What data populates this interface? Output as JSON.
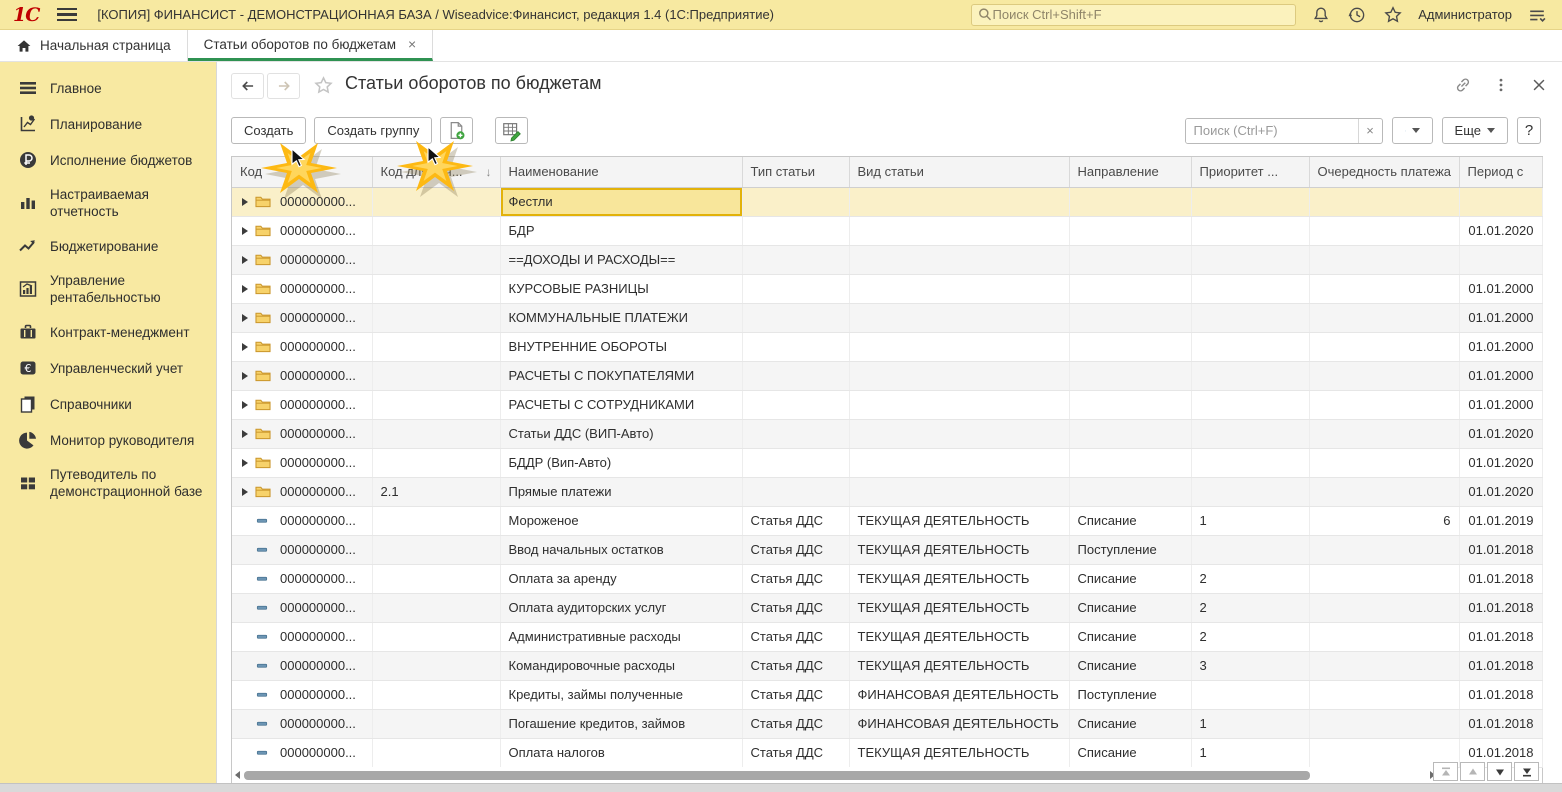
{
  "titlebar": {
    "logo": "1С",
    "title": "[КОПИЯ] ФИНАНСИСТ - ДЕМОНСТРАЦИОННАЯ БАЗА / Wiseadvice:Финансист, редакция 1.4  (1С:Предприятие)",
    "search_placeholder": "Поиск Ctrl+Shift+F",
    "user": "Администратор"
  },
  "tabs": [
    {
      "label": "Начальная страница",
      "icon": "home-icon",
      "active": false
    },
    {
      "label": "Статьи оборотов по бюджетам",
      "close": "×",
      "active": true
    }
  ],
  "sidebar": [
    {
      "label": "Главное",
      "icon": "menu"
    },
    {
      "label": "Планирование",
      "icon": "planning"
    },
    {
      "label": "Исполнение бюджетов",
      "icon": "ruble"
    },
    {
      "label": "Настраиваемая отчетность",
      "icon": "bars"
    },
    {
      "label": "Бюджетирование",
      "icon": "trend"
    },
    {
      "label": "Управление рентабельностью",
      "icon": "chartframe"
    },
    {
      "label": "Контракт-менеджмент",
      "icon": "briefcase"
    },
    {
      "label": "Управленческий учет",
      "icon": "euro"
    },
    {
      "label": "Справочники",
      "icon": "pages"
    },
    {
      "label": "Монитор руководителя",
      "icon": "pie"
    },
    {
      "label": "Путеводитель по демонстрационной базе",
      "icon": "grid"
    }
  ],
  "page": {
    "title": "Статьи оборотов по бюджетам",
    "toolbar": {
      "create": "Создать",
      "create_group": "Создать группу",
      "search_placeholder": "Поиск (Ctrl+F)",
      "clear": "×",
      "more": "Еще",
      "help": "?"
    }
  },
  "table": {
    "columns": [
      "Код",
      "Код для отч...",
      "Наименование",
      "Тип статьи",
      "Вид статьи",
      "Направление",
      "Приоритет ...",
      "Очередность платежа",
      "Период с"
    ],
    "sort_arrow": "↓",
    "rows": [
      {
        "kind": "group",
        "code": "000000000...",
        "code2": "",
        "name": "Фестли",
        "type": "",
        "view": "",
        "direction": "",
        "priority": "",
        "order": "",
        "period": "",
        "selected": true
      },
      {
        "kind": "group",
        "code": "000000000...",
        "code2": "",
        "name": "БДР",
        "type": "",
        "view": "",
        "direction": "",
        "priority": "",
        "order": "",
        "period": "01.01.2020",
        "selected": false
      },
      {
        "kind": "group",
        "code": "000000000...",
        "code2": "",
        "name": "==ДОХОДЫ И РАСХОДЫ==",
        "type": "",
        "view": "",
        "direction": "",
        "priority": "",
        "order": "",
        "period": "",
        "selected": false
      },
      {
        "kind": "group",
        "code": "000000000...",
        "code2": "",
        "name": "КУРСОВЫЕ РАЗНИЦЫ",
        "type": "",
        "view": "",
        "direction": "",
        "priority": "",
        "order": "",
        "period": "01.01.2000",
        "selected": false
      },
      {
        "kind": "group",
        "code": "000000000...",
        "code2": "",
        "name": "КОММУНАЛЬНЫЕ ПЛАТЕЖИ",
        "type": "",
        "view": "",
        "direction": "",
        "priority": "",
        "order": "",
        "period": "01.01.2000",
        "selected": false
      },
      {
        "kind": "group",
        "code": "000000000...",
        "code2": "",
        "name": "ВНУТРЕННИЕ ОБОРОТЫ",
        "type": "",
        "view": "",
        "direction": "",
        "priority": "",
        "order": "",
        "period": "01.01.2000",
        "selected": false
      },
      {
        "kind": "group",
        "code": "000000000...",
        "code2": "",
        "name": "РАСЧЕТЫ С ПОКУПАТЕЛЯМИ",
        "type": "",
        "view": "",
        "direction": "",
        "priority": "",
        "order": "",
        "period": "01.01.2000",
        "selected": false
      },
      {
        "kind": "group",
        "code": "000000000...",
        "code2": "",
        "name": "РАСЧЕТЫ С СОТРУДНИКАМИ",
        "type": "",
        "view": "",
        "direction": "",
        "priority": "",
        "order": "",
        "period": "01.01.2000",
        "selected": false
      },
      {
        "kind": "group",
        "code": "000000000...",
        "code2": "",
        "name": "Статьи ДДС (ВИП-Авто)",
        "type": "",
        "view": "",
        "direction": "",
        "priority": "",
        "order": "",
        "period": "01.01.2020",
        "selected": false
      },
      {
        "kind": "group",
        "code": "000000000...",
        "code2": "",
        "name": "БДДР (Вип-Авто)",
        "type": "",
        "view": "",
        "direction": "",
        "priority": "",
        "order": "",
        "period": "01.01.2020",
        "selected": false
      },
      {
        "kind": "group",
        "code": "000000000...",
        "code2": "2.1",
        "name": "Прямые платежи",
        "type": "",
        "view": "",
        "direction": "",
        "priority": "",
        "order": "",
        "period": "01.01.2020",
        "selected": false
      },
      {
        "kind": "item",
        "code": "000000000...",
        "code2": "",
        "name": "Мороженое",
        "type": "Статья ДДС",
        "view": "ТЕКУЩАЯ ДЕЯТЕЛЬНОСТЬ",
        "direction": "Списание",
        "priority": "1",
        "order": "6",
        "period": "01.01.2019",
        "selected": false
      },
      {
        "kind": "item",
        "code": "000000000...",
        "code2": "",
        "name": "Ввод начальных остатков",
        "type": "Статья ДДС",
        "view": "ТЕКУЩАЯ ДЕЯТЕЛЬНОСТЬ",
        "direction": "Поступление",
        "priority": "",
        "order": "",
        "period": "01.01.2018",
        "selected": false
      },
      {
        "kind": "item",
        "code": "000000000...",
        "code2": "",
        "name": "Оплата за аренду",
        "type": "Статья ДДС",
        "view": "ТЕКУЩАЯ ДЕЯТЕЛЬНОСТЬ",
        "direction": "Списание",
        "priority": "2",
        "order": "",
        "period": "01.01.2018",
        "selected": false
      },
      {
        "kind": "item",
        "code": "000000000...",
        "code2": "",
        "name": "Оплата аудиторских услуг",
        "type": "Статья ДДС",
        "view": "ТЕКУЩАЯ ДЕЯТЕЛЬНОСТЬ",
        "direction": "Списание",
        "priority": "2",
        "order": "",
        "period": "01.01.2018",
        "selected": false
      },
      {
        "kind": "item",
        "code": "000000000...",
        "code2": "",
        "name": "Административные расходы",
        "type": "Статья ДДС",
        "view": "ТЕКУЩАЯ ДЕЯТЕЛЬНОСТЬ",
        "direction": "Списание",
        "priority": "2",
        "order": "",
        "period": "01.01.2018",
        "selected": false
      },
      {
        "kind": "item",
        "code": "000000000...",
        "code2": "",
        "name": "Командировочные расходы",
        "type": "Статья ДДС",
        "view": "ТЕКУЩАЯ ДЕЯТЕЛЬНОСТЬ",
        "direction": "Списание",
        "priority": "3",
        "order": "",
        "period": "01.01.2018",
        "selected": false
      },
      {
        "kind": "item",
        "code": "000000000...",
        "code2": "",
        "name": "Кредиты, займы полученные",
        "type": "Статья ДДС",
        "view": "ФИНАНСОВАЯ ДЕЯТЕЛЬНОСТЬ",
        "direction": "Поступление",
        "priority": "",
        "order": "",
        "period": "01.01.2018",
        "selected": false
      },
      {
        "kind": "item",
        "code": "000000000...",
        "code2": "",
        "name": "Погашение кредитов, займов",
        "type": "Статья ДДС",
        "view": "ФИНАНСОВАЯ ДЕЯТЕЛЬНОСТЬ",
        "direction": "Списание",
        "priority": "1",
        "order": "",
        "period": "01.01.2018",
        "selected": false
      },
      {
        "kind": "item",
        "code": "000000000...",
        "code2": "",
        "name": "Оплата налогов",
        "type": "Статья ДДС",
        "view": "ТЕКУЩАЯ ДЕЯТЕЛЬНОСТЬ",
        "direction": "Списание",
        "priority": "1",
        "order": "",
        "period": "01.01.2018",
        "selected": false
      }
    ]
  },
  "colors": {
    "titlebar_bg": "#f7e9a1",
    "sidebar_bg": "#f8e9a2",
    "tab_active_green": "#2f9252",
    "selected_row_bg": "#faf0c9",
    "active_cell_bg": "#f8e69b",
    "active_cell_border": "#e2b20a"
  }
}
